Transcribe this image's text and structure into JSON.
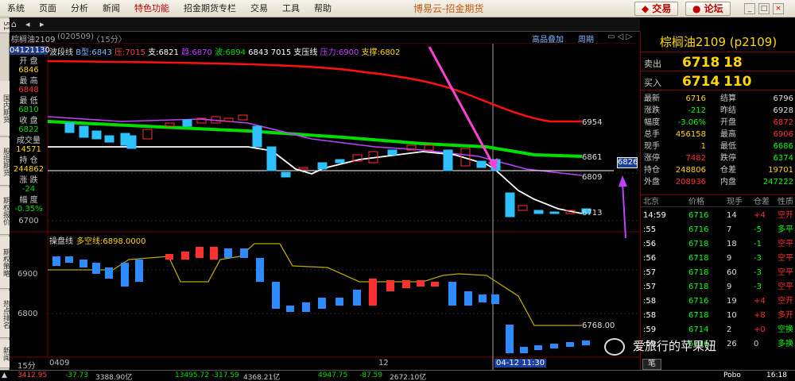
{
  "menu": [
    "系统",
    "页面",
    "分析",
    "新闻",
    "特色功能",
    "招金期货专栏",
    "交易",
    "工具",
    "帮助"
  ],
  "app_title": "博易云-招金期货",
  "buttons": {
    "trade": "交易",
    "forum": "论坛"
  },
  "window": {
    "minimize": "_",
    "restore": "□",
    "close": "×"
  },
  "chart_header": {
    "symbol": "棕榈油2109",
    "code": "(020509)",
    "period": "〈15分〉",
    "advanced_overlay": "高品叠加",
    "cycle": "周期"
  },
  "left_tabs": [
    "51",
    "国内期货",
    "股指期货",
    "期权报价",
    "期权策略",
    "热点排名",
    "新闻"
  ],
  "info_panel": {
    "time": "04121130",
    "open_label": "开  盘",
    "open": "6846",
    "high_label": "最  高",
    "high": "6848",
    "low_label": "最  低",
    "low": "6810",
    "close_label": "收  盘",
    "close": "6822",
    "volume_label": "成交量",
    "volume": "14571",
    "oi_label": "持  仓",
    "oi": "244862",
    "change_label": "涨  跌",
    "change": "-24",
    "pct_label": "幅  度",
    "pct": "-0.35%"
  },
  "indicator_line": {
    "name": "波段线",
    "b_label": "B型:6843",
    "pressure": "压:7015",
    "support": "支:6821",
    "mid": "趋:6870",
    "wave": "波:6894",
    "vals": "6843 7015",
    "zhiya": "支压线",
    "pressure2": "压力:6900",
    "support2": "支撑:6802"
  },
  "price_labels": {
    "p6954": "6954",
    "p6861": "6861",
    "p6809": "6809",
    "p6713": "6713",
    "p6826": "6826",
    "y6700": "6700"
  },
  "lower_panel": {
    "name": "操盘线",
    "desc": "多空线:6898.0000",
    "y6900": "6900",
    "y6800": "6800",
    "p6768": "6768.00"
  },
  "x_axis": {
    "left": "0409",
    "mid": "12",
    "cursor": "04-12 11:30",
    "period_label": "15分"
  },
  "right_panel": {
    "title": "棕榈油2109 (p2109)",
    "sell_label": "卖出",
    "sell_price": "6718",
    "sell_vol": "18",
    "buy_label": "买入",
    "buy_price": "6714",
    "buy_vol": "110",
    "stats": [
      [
        "最新",
        "6716",
        "结算",
        "6796"
      ],
      [
        "涨跌",
        "-212",
        "昨结",
        "6928"
      ],
      [
        "幅度",
        "-3.06%",
        "开盘",
        "6872"
      ],
      [
        "总手",
        "456158",
        "最高",
        "6906"
      ],
      [
        "现手",
        "1",
        "最低",
        "6686"
      ],
      [
        "涨停",
        "7482",
        "跌停",
        "6374"
      ],
      [
        "持仓",
        "248806",
        "仓差",
        "19701"
      ],
      [
        "外盘",
        "208936",
        "内盘",
        "247222"
      ]
    ],
    "tick_header": [
      "北京",
      "价格",
      "现手",
      "仓差",
      "性质"
    ],
    "ticks": [
      [
        "14:59",
        "6716",
        "14",
        "+4",
        "空开"
      ],
      [
        ":55",
        "6716",
        "7",
        "-5",
        "多平"
      ],
      [
        ":56",
        "6718",
        "18",
        "-1",
        "空平"
      ],
      [
        ":56",
        "6718",
        "9",
        "-3",
        "空平"
      ],
      [
        ":57",
        "6718",
        "60",
        "-3",
        "空平"
      ],
      [
        ":57",
        "6718",
        "9",
        "-3",
        "空平"
      ],
      [
        ":58",
        "6716",
        "19",
        "+4",
        "空开"
      ],
      [
        ":58",
        "6718",
        "10",
        "+8",
        "多开"
      ],
      [
        ":59",
        "6714",
        "2",
        "+0",
        "空换"
      ],
      [
        ":59",
        "6716",
        "26",
        "0",
        "多换"
      ]
    ],
    "bottom_tab": "笔"
  },
  "watermark": "爱旅行的苹果妞",
  "bottom_bar": [
    "3412.95",
    "-37.73",
    "3388.90亿",
    "13495.72",
    "-317.59",
    "4368.21亿",
    "4947.75",
    "-87.59",
    "2672.10亿"
  ],
  "bottom_right": {
    "brand": "Pobo",
    "time": "16:18"
  },
  "colors": {
    "up": "#ff3030",
    "down": "#2e8bff",
    "yellow": "#ffd700",
    "green": "#00ff00",
    "ma": "#c8b400"
  }
}
